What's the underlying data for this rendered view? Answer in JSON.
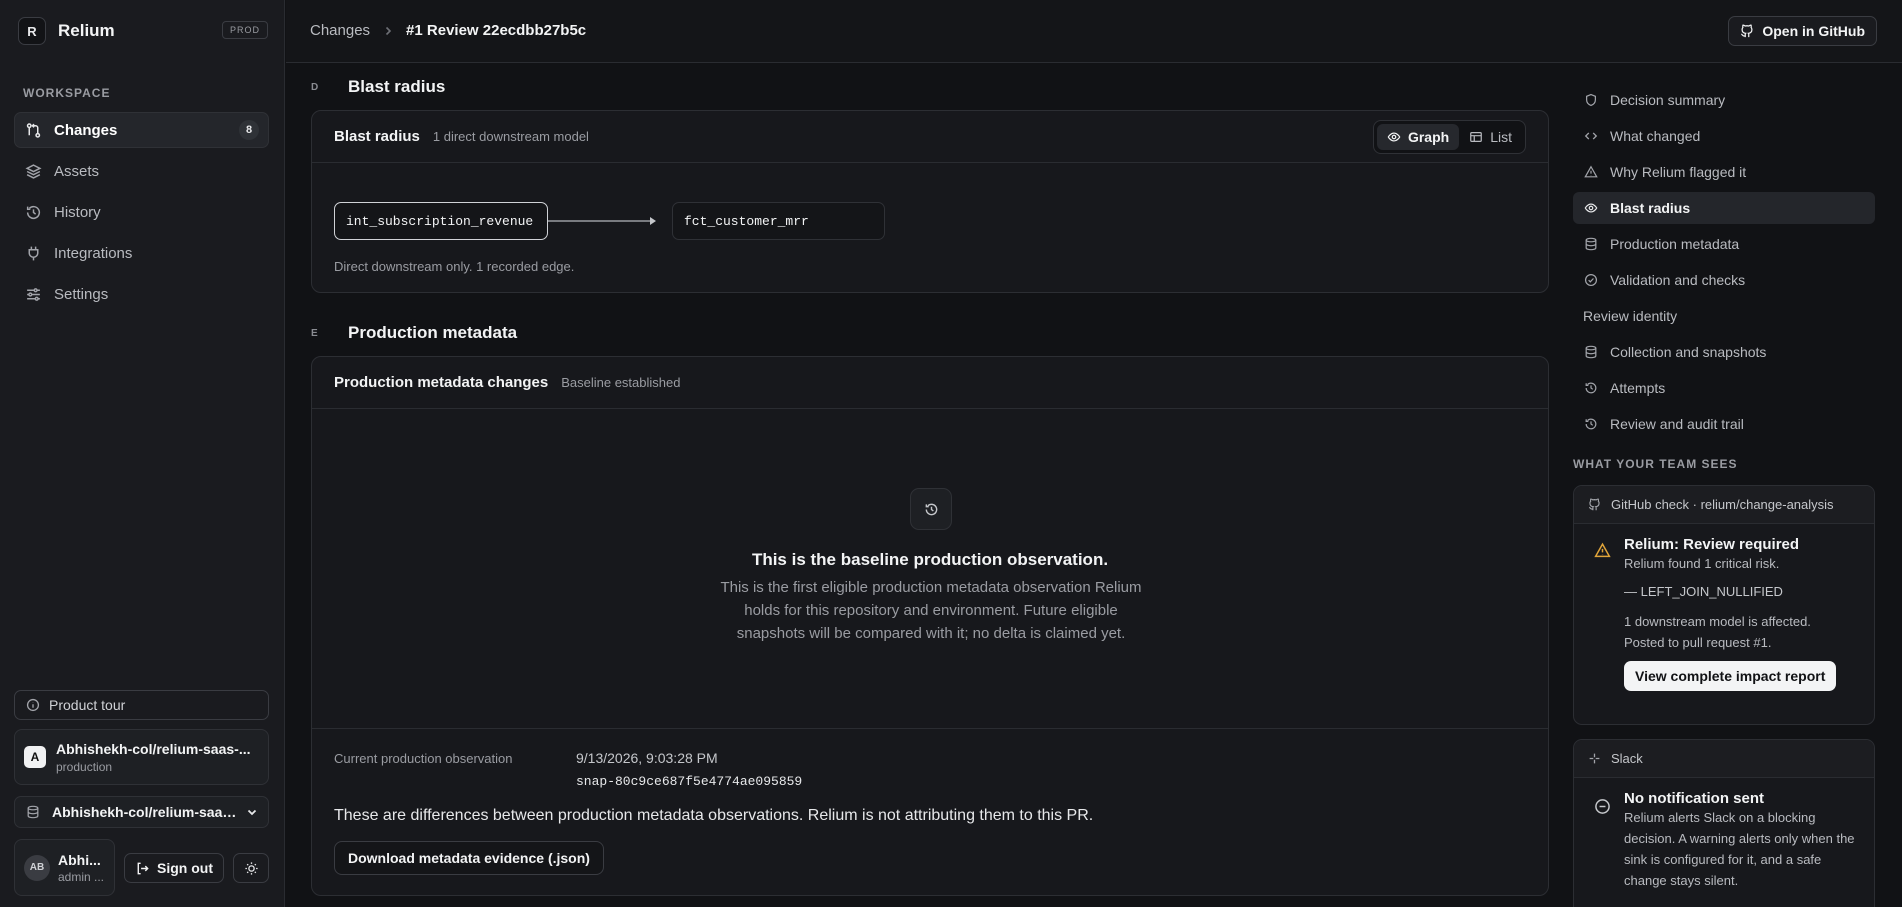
{
  "sidebar": {
    "brand_initial": "R",
    "brand_name": "Relium",
    "env_badge": "PROD",
    "workspace_label": "WORKSPACE",
    "nav": [
      {
        "label": "Changes",
        "icon": "git-compare-icon",
        "count": "8",
        "active": true
      },
      {
        "label": "Assets",
        "icon": "layers-icon"
      },
      {
        "label": "History",
        "icon": "history-icon"
      },
      {
        "label": "Integrations",
        "icon": "plug-icon"
      },
      {
        "label": "Settings",
        "icon": "sliders-icon"
      }
    ],
    "product_tour": "Product tour",
    "repo_card": {
      "initial": "A",
      "name": "Abhishekh-col/relium-saas-...",
      "env": "production"
    },
    "repo_select": "Abhishekh-col/relium-saas-...",
    "user": {
      "initials": "AB",
      "name": "Abhi...",
      "role": "admin ..."
    },
    "sign_out": "Sign out"
  },
  "topbar": {
    "crumb_root": "Changes",
    "crumb_current": "#1 Review 22ecdbb27b5c",
    "github_button": "Open in GitHub"
  },
  "sections": {
    "blast": {
      "letter": "D",
      "title": "Blast radius",
      "card_title": "Blast radius",
      "card_sub": "1 direct downstream model",
      "toggle": [
        "Graph",
        "List"
      ],
      "source_node": "int_subscription_revenue",
      "target_node": "fct_customer_mrr",
      "note": "Direct downstream only. 1 recorded edge."
    },
    "metadata": {
      "letter": "E",
      "title": "Production metadata",
      "card_title": "Production metadata changes",
      "card_sub": "Baseline established",
      "empty_title": "This is the baseline production observation.",
      "empty_desc": "This is the first eligible production metadata observation Relium holds for this repository and environment. Future eligible snapshots will be compared with it; no delta is claimed yet.",
      "obs_label": "Current production observation",
      "obs_time": "9/13/2026, 9:03:28 PM",
      "obs_snapshot": "snap-80c9ce687f5e4774ae095859",
      "note": "These are differences between production metadata observations. Relium is not attributing them to this PR.",
      "download_button": "Download metadata evidence (.json)"
    }
  },
  "toc": [
    {
      "label": "Decision summary",
      "icon": "shield-icon"
    },
    {
      "label": "What changed",
      "icon": "code-icon"
    },
    {
      "label": "Why Relium flagged it",
      "icon": "warning-icon"
    },
    {
      "label": "Blast radius",
      "icon": "eye-icon",
      "active": true
    },
    {
      "label": "Production metadata",
      "icon": "database-icon"
    },
    {
      "label": "Validation and checks",
      "icon": "check-circle-icon"
    },
    {
      "label": "Review identity",
      "icon": ""
    },
    {
      "label": "Collection and snapshots",
      "icon": "database-icon"
    },
    {
      "label": "Attempts",
      "icon": "history-icon"
    },
    {
      "label": "Review and audit trail",
      "icon": "history-icon"
    }
  ],
  "team": {
    "label": "WHAT YOUR TEAM SEES",
    "github": {
      "header": "GitHub check · relium/change-analysis",
      "title": "Relium: Review required",
      "line1": "Relium found 1 critical risk.",
      "risk": "—  LEFT_JOIN_NULLIFIED",
      "line2": "1 downstream model is affected.",
      "line3": "Posted to pull request #1.",
      "button": "View complete impact report"
    },
    "slack": {
      "header": "Slack",
      "title": "No notification sent",
      "text": "Relium alerts Slack on a blocking decision. A warning alerts only when the sink is configured for it, and a safe change stays silent."
    }
  },
  "colors": {
    "accent": "#f3f4f5",
    "warning": "#e0a43a",
    "background": "#111215",
    "sidebar": "#1a1b1f"
  }
}
